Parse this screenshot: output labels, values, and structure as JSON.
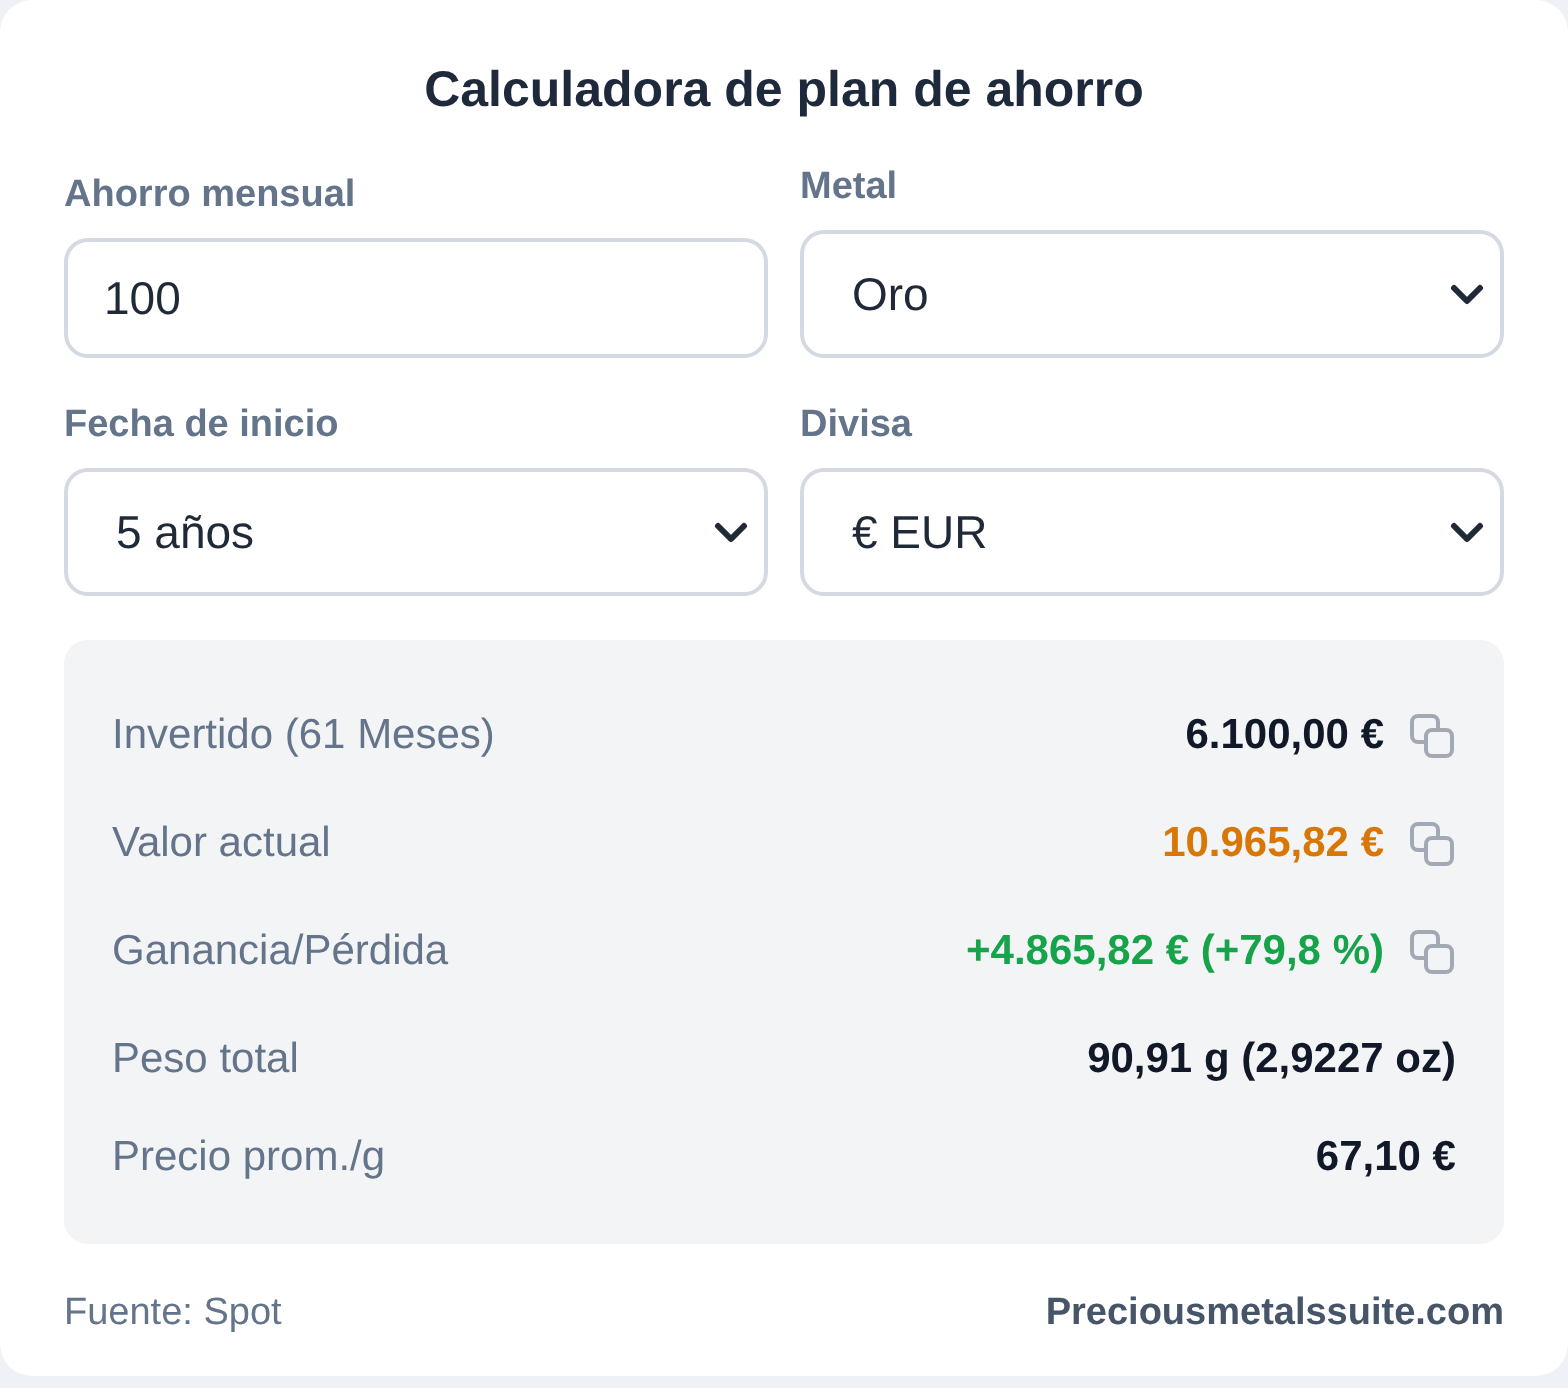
{
  "title": "Calculadora de plan de ahorro",
  "fields": [
    {
      "label": "Ahorro mensual",
      "kind": "input",
      "value": "100"
    },
    {
      "label": "Metal",
      "kind": "select",
      "value": "Oro"
    },
    {
      "label": "Fecha de inicio",
      "kind": "select",
      "value": "5 años"
    },
    {
      "label": "Divisa",
      "kind": "select",
      "value": "€ EUR"
    }
  ],
  "results": [
    {
      "label": "Invertido (61 Meses)",
      "value": "6.100,00 €",
      "color": "#111827",
      "copyable": true
    },
    {
      "label": "Valor actual",
      "value": "10.965,82 €",
      "color": "#d97706",
      "copyable": true
    },
    {
      "label": "Ganancia/Pérdida",
      "value": "+4.865,82 € (+79,8 %)",
      "color": "#16a34a",
      "copyable": true
    },
    {
      "label": "Peso total",
      "value": "90,91 g (2,9227 oz)",
      "color": "#111827",
      "copyable": false
    },
    {
      "label": "Precio prom./g",
      "value": "67,10 €",
      "color": "#111827",
      "copyable": false
    }
  ],
  "footer": {
    "source": "Fuente: Spot",
    "site": "Preciousmetalssuite.com"
  }
}
